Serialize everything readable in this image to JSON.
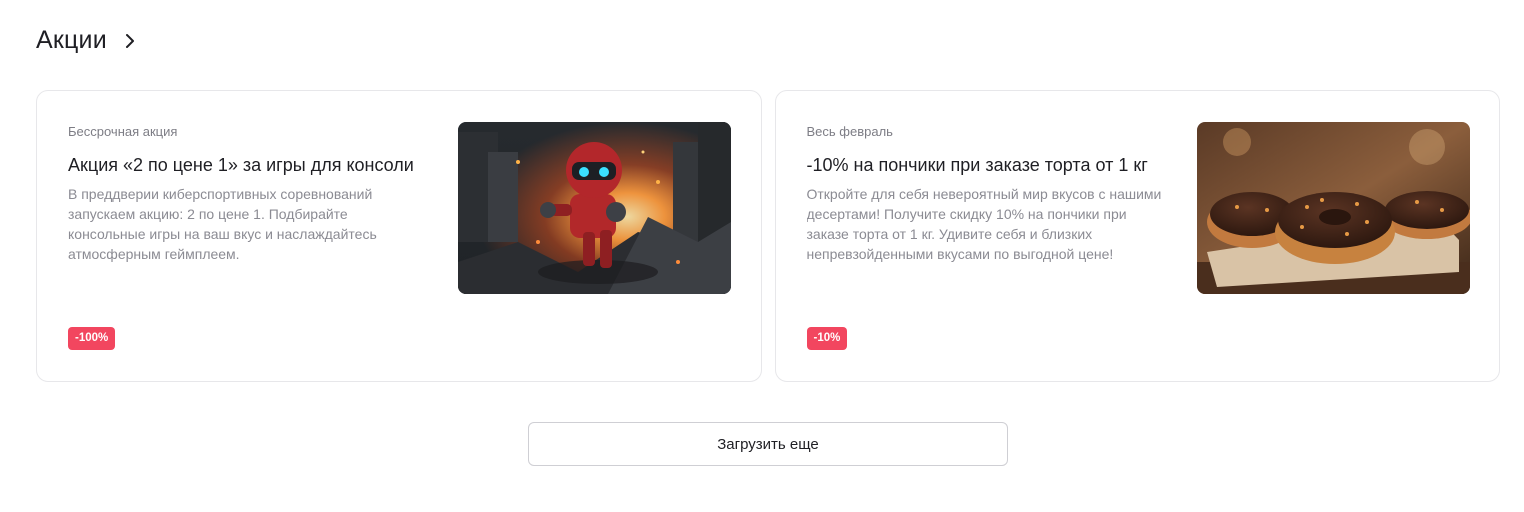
{
  "section": {
    "title": "Акции",
    "chevron_icon": "chevron-right-icon"
  },
  "promos": [
    {
      "period": "Бессрочная акция",
      "title": "Акция «2 по цене 1» за игры для консоли",
      "description": "В преддверии киберспортивных соревнований запускаем акцию: 2 по цене 1. Подбирайте консольные игры на ваш вкус и наслаждайтесь атмосферным геймплеем.",
      "badge": "-100%",
      "image": "robot-explosion-image"
    },
    {
      "period": "Весь февраль",
      "title": "-10% на пончики при заказе торта от 1 кг",
      "description": "Откройте для себя невероятный мир вкусов с нашими десертами! Получите скидку 10% на пончики при заказе торта от 1 кг. Удивите себя и близких непревзойденными вкусами по выгодной цене!",
      "badge": "-10%",
      "image": "chocolate-donuts-image"
    }
  ],
  "load_more_label": "Загрузить еще",
  "colors": {
    "badge": "#f2465f",
    "border": "#e7e7ea",
    "text": "#1f1f24",
    "muted": "#8b8b93"
  }
}
